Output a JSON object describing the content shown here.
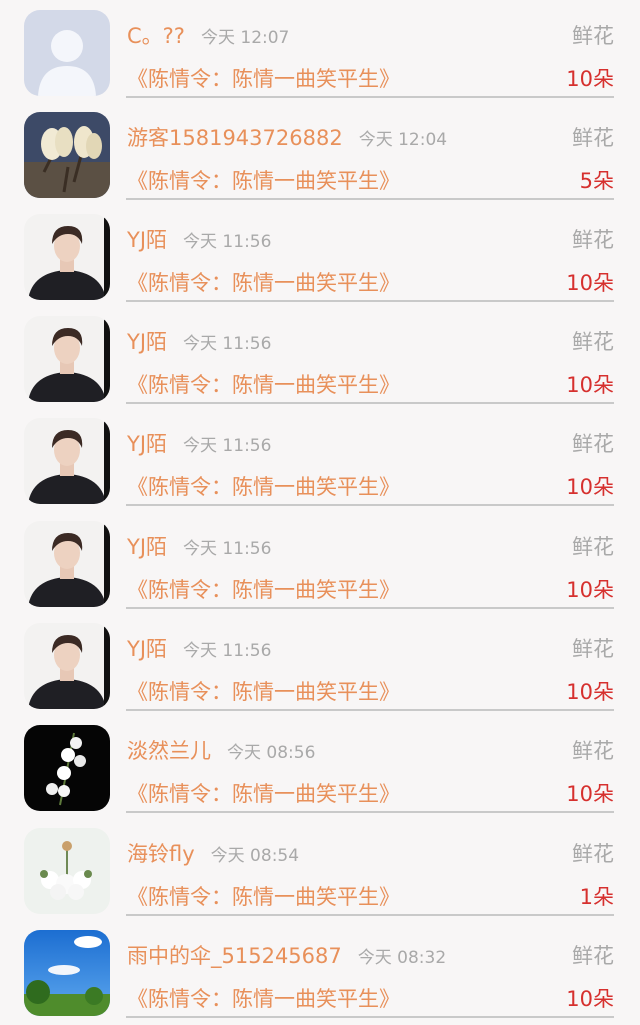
{
  "gift_records": [
    {
      "user": "C。??",
      "time": "今天 12:07",
      "gift": "鲜花",
      "book": "《陈情令：陈情一曲笑平生》",
      "count": "10朵",
      "avatar": "default-person-icon"
    },
    {
      "user": "游客1581943726882",
      "time": "今天 12:04",
      "gift": "鲜花",
      "book": "《陈情令：陈情一曲笑平生》",
      "count": "5朵",
      "avatar": "magnolia-flower-photo"
    },
    {
      "user": "YJ陌",
      "time": "今天 11:56",
      "gift": "鲜花",
      "book": "《陈情令：陈情一曲笑平生》",
      "count": "10朵",
      "avatar": "man-portrait-photo"
    },
    {
      "user": "YJ陌",
      "time": "今天 11:56",
      "gift": "鲜花",
      "book": "《陈情令：陈情一曲笑平生》",
      "count": "10朵",
      "avatar": "man-portrait-photo"
    },
    {
      "user": "YJ陌",
      "time": "今天 11:56",
      "gift": "鲜花",
      "book": "《陈情令：陈情一曲笑平生》",
      "count": "10朵",
      "avatar": "man-portrait-photo"
    },
    {
      "user": "YJ陌",
      "time": "今天 11:56",
      "gift": "鲜花",
      "book": "《陈情令：陈情一曲笑平生》",
      "count": "10朵",
      "avatar": "man-portrait-photo"
    },
    {
      "user": "YJ陌",
      "time": "今天 11:56",
      "gift": "鲜花",
      "book": "《陈情令：陈情一曲笑平生》",
      "count": "10朵",
      "avatar": "man-portrait-photo"
    },
    {
      "user": "淡然兰儿",
      "time": "今天 08:56",
      "gift": "鲜花",
      "book": "《陈情令：陈情一曲笑平生》",
      "count": "10朵",
      "avatar": "lily-of-the-valley-photo"
    },
    {
      "user": "海铃fly",
      "time": "今天 08:54",
      "gift": "鲜花",
      "book": "《陈情令：陈情一曲笑平生》",
      "count": "1朵",
      "avatar": "white-flower-bouquet-photo"
    },
    {
      "user": "雨中的伞_515245687",
      "time": "今天 08:32",
      "gift": "鲜花",
      "book": "《陈情令：陈情一曲笑平生》",
      "count": "10朵",
      "avatar": "sky-landscape-photo"
    }
  ],
  "colors": {
    "name_text": "#e8905a",
    "meta_text": "#a9a9a9",
    "count_text": "#d6302e",
    "divider": "#c9c9c9",
    "background": "#f8f6f6"
  }
}
